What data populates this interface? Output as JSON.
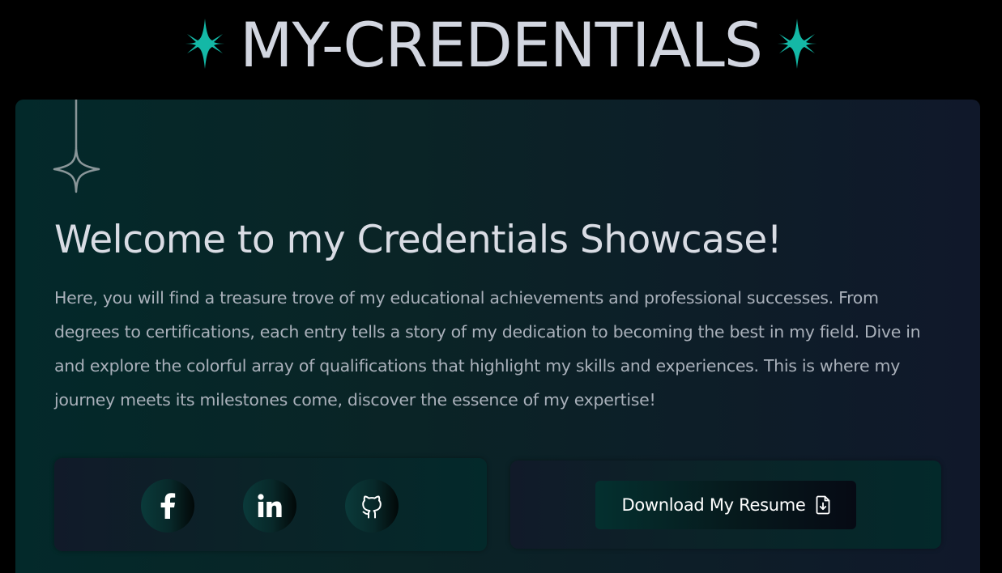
{
  "header": {
    "title": "MY-CREDENTIALS",
    "left_icon": "sparkle-icon",
    "right_icon": "sparkle-icon",
    "accent_color": "#14b8a6"
  },
  "intro": {
    "decoration_icon": "hanging-star-icon",
    "title": "Welcome to my Credentials Showcase!",
    "text": "Here, you will find a treasure trove of my educational achievements and professional successes. From degrees to certifications, each entry tells a story of my dedication to becoming the best in my field. Dive in and explore the colorful array of qualifications that highlight my skills and experiences. This is where my journey meets its milestones come, discover the essence of my expertise!"
  },
  "social": {
    "items": [
      {
        "name": "facebook",
        "icon": "facebook-icon"
      },
      {
        "name": "linkedin",
        "icon": "linkedin-icon"
      },
      {
        "name": "github",
        "icon": "github-icon"
      }
    ]
  },
  "resume": {
    "label": "Download My Resume",
    "icon": "file-download-icon"
  },
  "colors": {
    "background": "#000000",
    "title_text": "#d2d6e0",
    "body_text": "#a9b0ba",
    "card_start": "#03292a",
    "card_end": "#10182a"
  }
}
